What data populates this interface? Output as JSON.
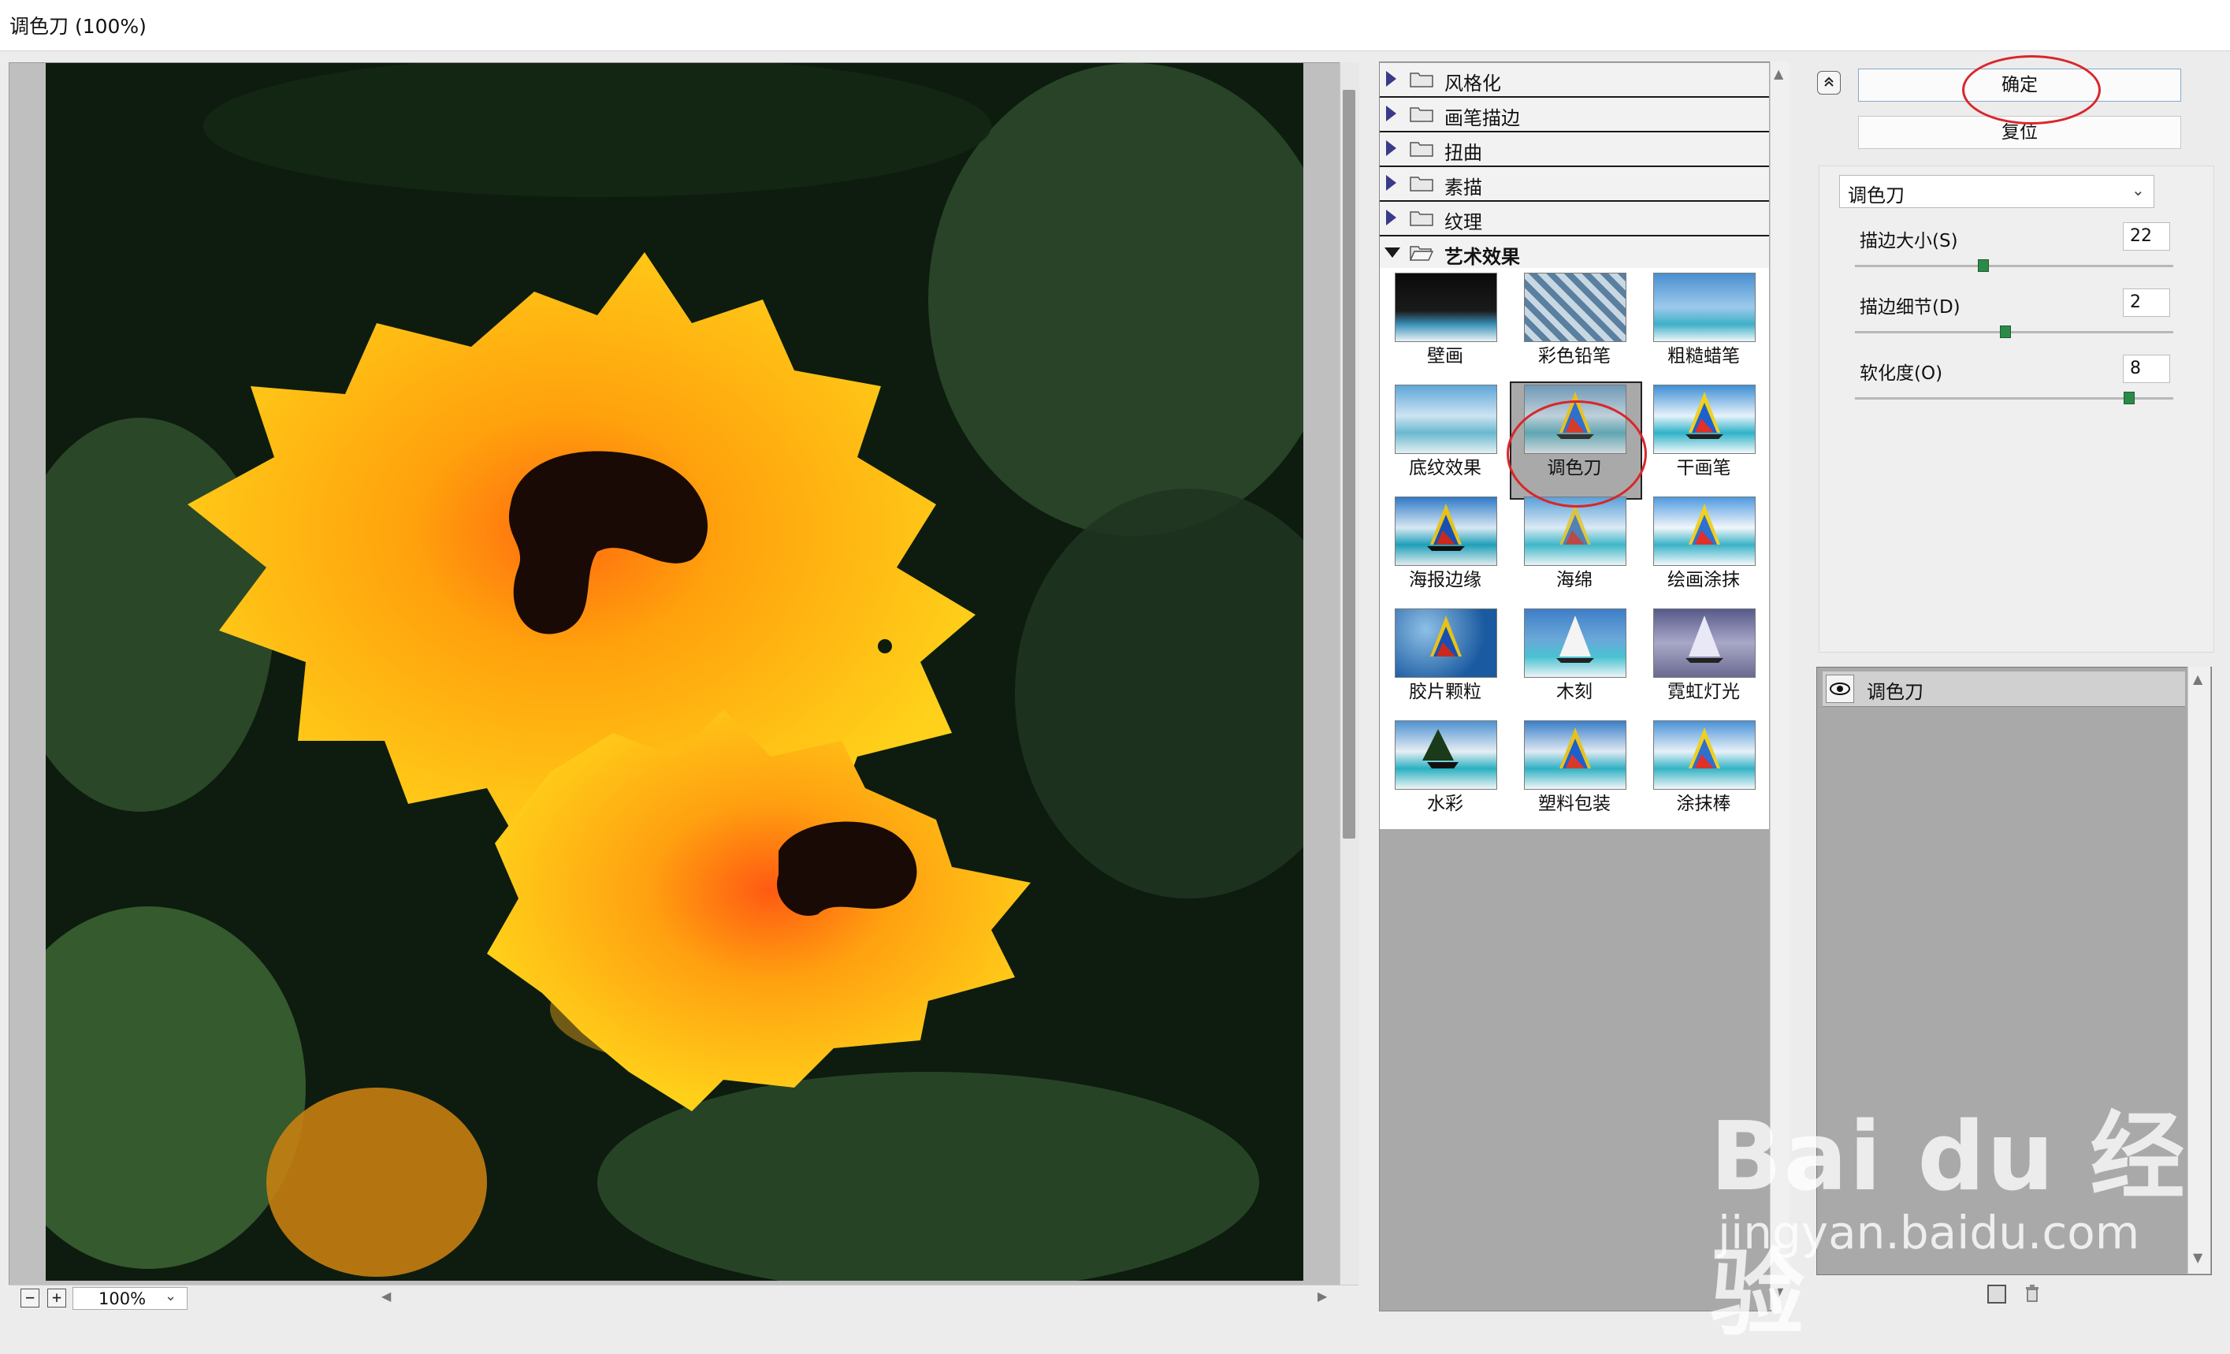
{
  "window": {
    "title": "调色刀 (100%)"
  },
  "preview": {
    "zoom": "100%",
    "zoom_out_symbol": "−",
    "zoom_in_symbol": "+"
  },
  "filter_browser": {
    "categories": [
      {
        "label": "风格化",
        "expanded": false
      },
      {
        "label": "画笔描边",
        "expanded": false
      },
      {
        "label": "扭曲",
        "expanded": false
      },
      {
        "label": "素描",
        "expanded": false
      },
      {
        "label": "纹理",
        "expanded": false
      },
      {
        "label": "艺术效果",
        "expanded": true
      }
    ],
    "thumbnails": [
      {
        "label": "壁画"
      },
      {
        "label": "彩色铅笔"
      },
      {
        "label": "粗糙蜡笔"
      },
      {
        "label": "底纹效果"
      },
      {
        "label": "调色刀",
        "selected": true
      },
      {
        "label": "干画笔"
      },
      {
        "label": "海报边缘"
      },
      {
        "label": "海绵"
      },
      {
        "label": "绘画涂抹"
      },
      {
        "label": "胶片颗粒"
      },
      {
        "label": "木刻"
      },
      {
        "label": "霓虹灯光"
      },
      {
        "label": "水彩"
      },
      {
        "label": "塑料包装"
      },
      {
        "label": "涂抹棒"
      }
    ]
  },
  "settings": {
    "ok_label": "确定",
    "reset_label": "复位",
    "selected_filter": "调色刀",
    "params": [
      {
        "label": "描边大小(S)",
        "value": "22",
        "fraction": 0.4
      },
      {
        "label": "描边细节(D)",
        "value": "2",
        "fraction": 0.47
      },
      {
        "label": "软化度(O)",
        "value": "8",
        "fraction": 0.86
      }
    ]
  },
  "layers": {
    "items": [
      {
        "label": "调色刀"
      }
    ]
  },
  "watermark": {
    "logo": "Bai  du 经验",
    "url": "jingyan.baidu.com"
  },
  "colors": {
    "annotation_red": "#d9262b",
    "slider_green": "#2b8a48"
  }
}
